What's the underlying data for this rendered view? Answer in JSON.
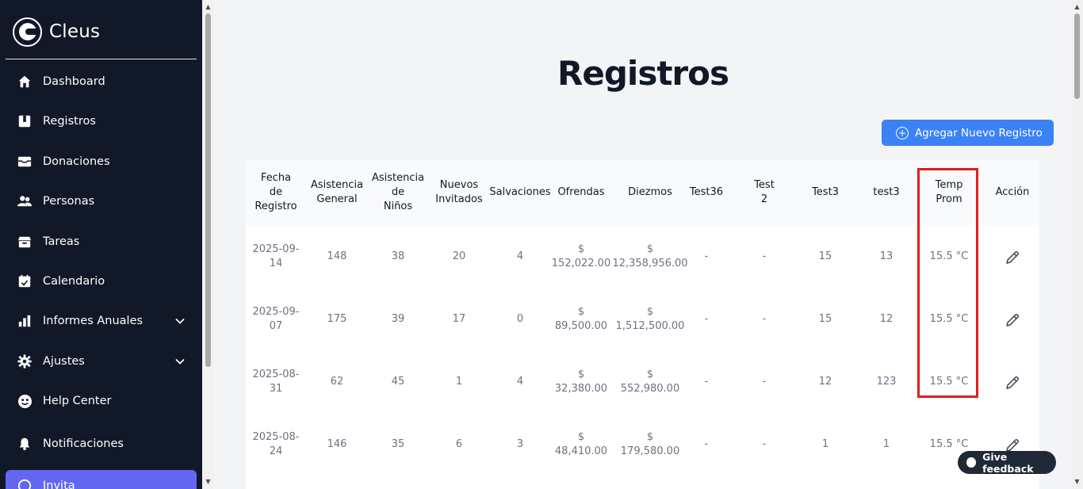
{
  "brand": {
    "name": "Cleus"
  },
  "sidebar": {
    "items": [
      {
        "label": "Dashboard",
        "icon": "home-icon"
      },
      {
        "label": "Registros",
        "icon": "book-icon"
      },
      {
        "label": "Donaciones",
        "icon": "inbox-icon"
      },
      {
        "label": "Personas",
        "icon": "users-icon"
      },
      {
        "label": "Tareas",
        "icon": "archive-icon"
      },
      {
        "label": "Calendario",
        "icon": "calendar-icon"
      },
      {
        "label": "Informes Anuales",
        "icon": "chart-bar-icon",
        "expandable": true
      },
      {
        "label": "Ajustes",
        "icon": "gear-icon",
        "expandable": true
      },
      {
        "label": "Help Center",
        "icon": "smiley-icon"
      },
      {
        "label": "Notificaciones",
        "icon": "bell-icon"
      },
      {
        "label": "Invita",
        "icon": "whatsapp-icon",
        "active": true
      }
    ]
  },
  "main": {
    "title": "Registros",
    "add_button": "Agregar Nuevo Registro"
  },
  "table": {
    "headers": [
      [
        "Fecha",
        "de",
        "Registro"
      ],
      [
        "Asistencia",
        "General"
      ],
      [
        "Asistencia",
        "de",
        "Niños"
      ],
      [
        "Nuevos",
        "Invitados"
      ],
      [
        "Salvaciones"
      ],
      [
        "Ofrendas"
      ],
      [
        "Diezmos"
      ],
      [
        "Test36"
      ],
      [
        "Test",
        "2"
      ],
      [
        "Test3"
      ],
      [
        "test3"
      ],
      [
        "Temp",
        "Prom"
      ],
      [
        "Acción"
      ]
    ],
    "rows": [
      {
        "fecha": [
          "2025-09-",
          "14"
        ],
        "general": "148",
        "ninos": "38",
        "invitados": "20",
        "salvaciones": "4",
        "ofrendas": [
          "$",
          "152,022.00"
        ],
        "diezmos": [
          "$",
          "12,358,956.00"
        ],
        "test36": "-",
        "test2": "-",
        "test3": "15",
        "test3b": "13",
        "temp": "15.5 °C"
      },
      {
        "fecha": [
          "2025-09-",
          "07"
        ],
        "general": "175",
        "ninos": "39",
        "invitados": "17",
        "salvaciones": "0",
        "ofrendas": [
          "$",
          "89,500.00"
        ],
        "diezmos": [
          "$",
          "1,512,500.00"
        ],
        "test36": "-",
        "test2": "-",
        "test3": "15",
        "test3b": "12",
        "temp": "15.5 °C"
      },
      {
        "fecha": [
          "2025-08-",
          "31"
        ],
        "general": "62",
        "ninos": "45",
        "invitados": "1",
        "salvaciones": "4",
        "ofrendas": [
          "$",
          "32,380.00"
        ],
        "diezmos": [
          "$",
          "552,980.00"
        ],
        "test36": "-",
        "test2": "-",
        "test3": "12",
        "test3b": "123",
        "temp": "15.5 °C"
      },
      {
        "fecha": [
          "2025-08-",
          "24"
        ],
        "general": "146",
        "ninos": "35",
        "invitados": "6",
        "salvaciones": "3",
        "ofrendas": [
          "$",
          "48,410.00"
        ],
        "diezmos": [
          "$",
          "179,580.00"
        ],
        "test36": "-",
        "test2": "-",
        "test3": "1",
        "test3b": "1",
        "temp": "15.5 °C"
      }
    ]
  },
  "feedback": {
    "label": "Give feedback"
  },
  "colors": {
    "sidebar_bg": "#111827",
    "accent": "#3b82f6",
    "active": "#6366f1",
    "highlight": "#e11d1d"
  }
}
